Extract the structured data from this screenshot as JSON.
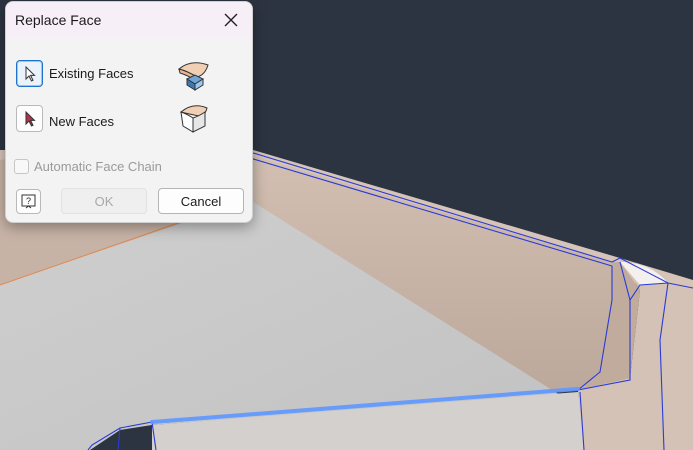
{
  "dialog": {
    "title": "Replace Face",
    "existing_faces_label": "Existing Faces",
    "new_faces_label": "New Faces",
    "auto_chain_label": "Automatic Face Chain",
    "auto_chain_checked": false,
    "ok_label": "OK",
    "cancel_label": "Cancel",
    "help_glyph": "?"
  },
  "colors": {
    "viewport_bg": "#2d3441",
    "model_face": "#c9b4a6",
    "edge_blue": "#2a3bd6",
    "highlight_edge": "#5d97ff",
    "accent": "#1e72c8"
  },
  "icons": [
    "close-icon",
    "select-arrow-icon",
    "select-arrow-red-icon",
    "existing-faces-icon",
    "new-faces-icon",
    "help-icon"
  ]
}
